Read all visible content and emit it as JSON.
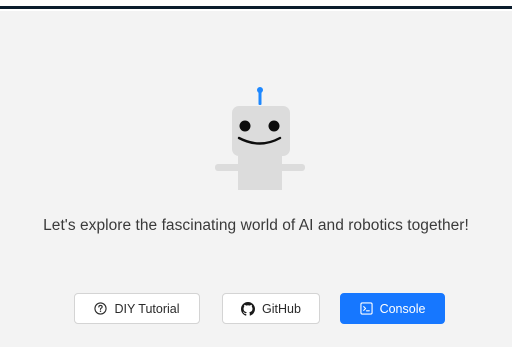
{
  "main": {
    "tagline": "Let's explore the fascinating world of AI and robotics together!"
  },
  "actions": {
    "tutorial_label": "DIY Tutorial",
    "github_label": "GitHub",
    "console_label": "Console"
  },
  "icons": {
    "tutorial": "question-circle-icon",
    "github": "github-icon",
    "console": "terminal-icon",
    "mascot": "robot-illustration"
  },
  "colors": {
    "accent": "#1677ff",
    "antenna": "#1e88ff",
    "robot_body": "#dcdcdc",
    "panel_bg": "#f3f3f3",
    "top_line": "#0b1c2c"
  }
}
